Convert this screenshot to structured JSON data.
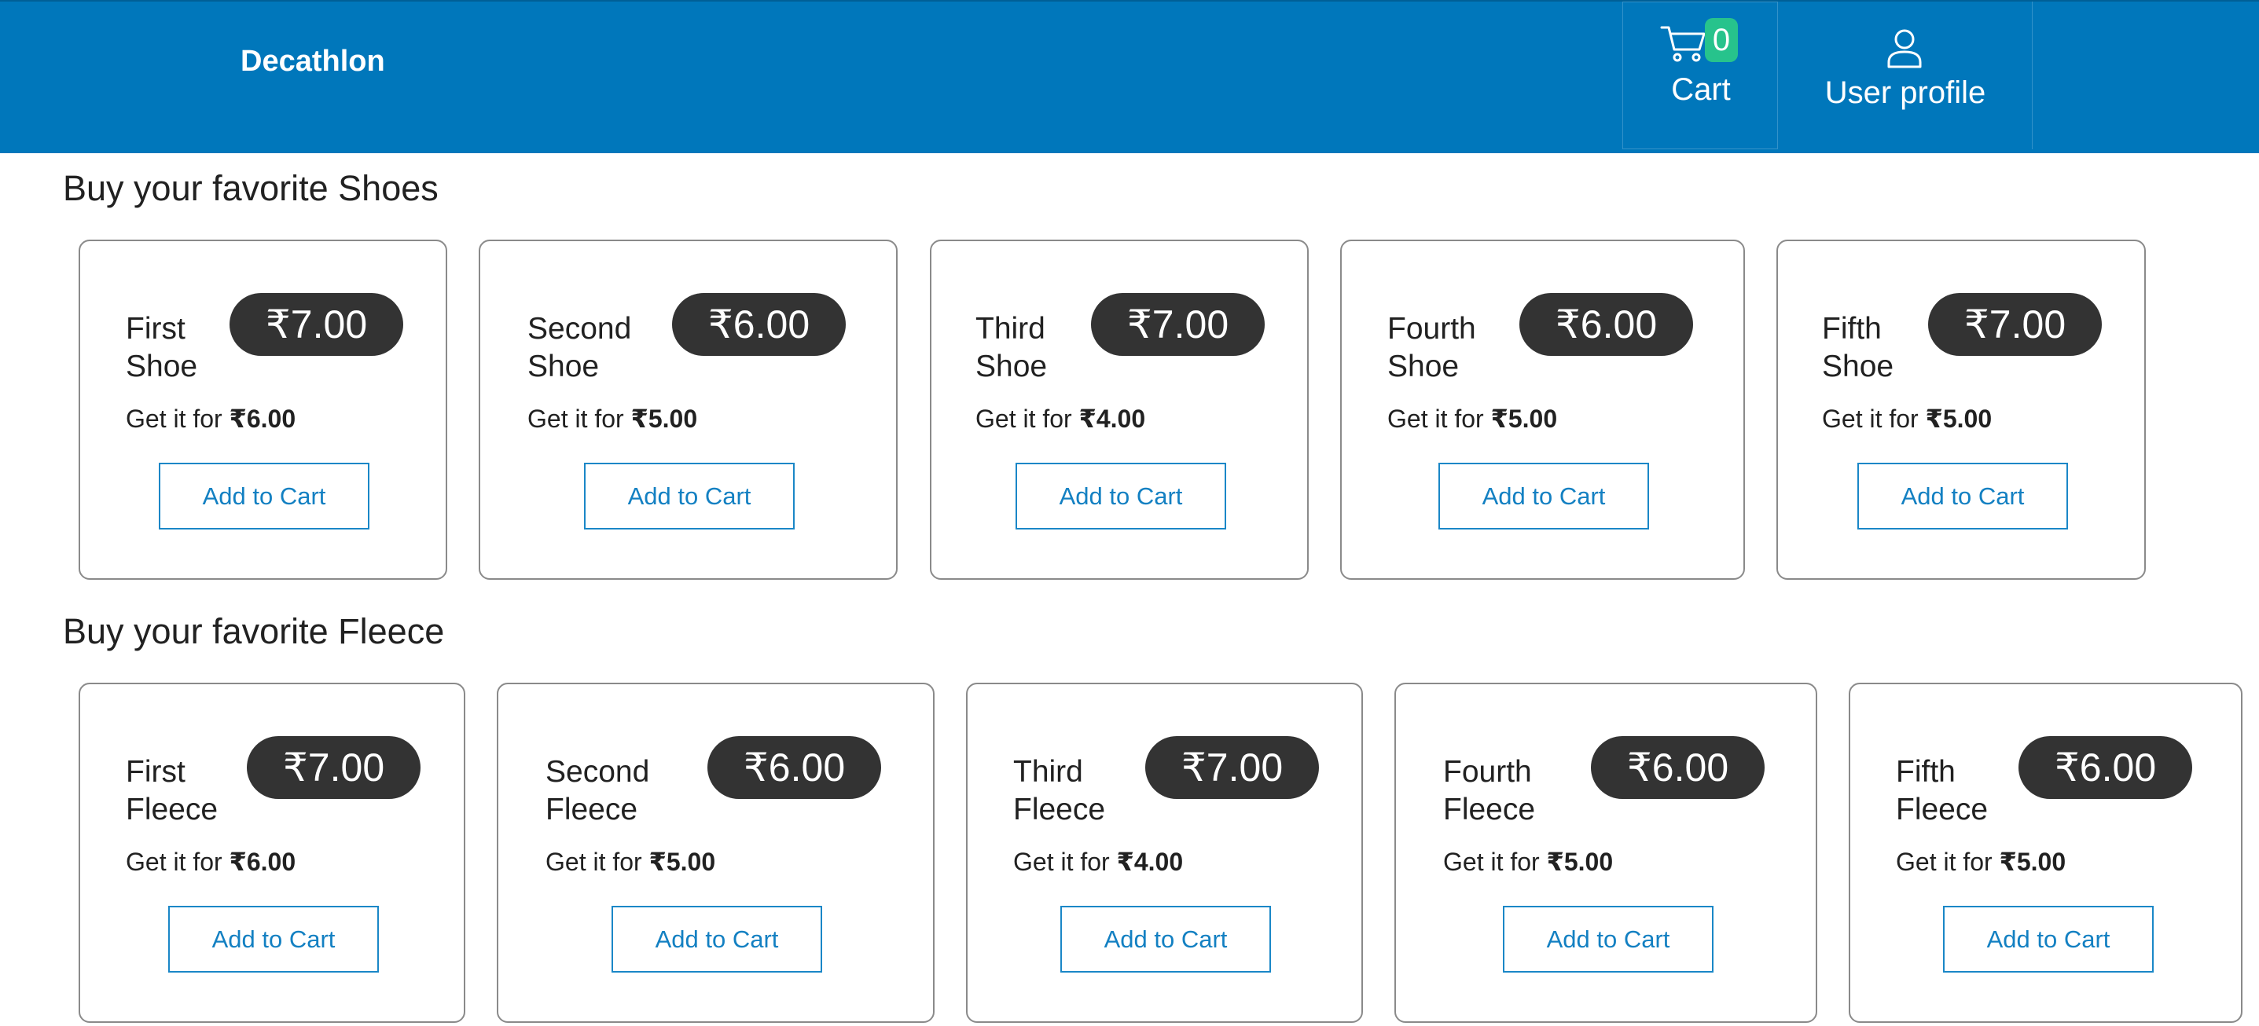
{
  "header": {
    "brand": "Decathlon",
    "cart": {
      "label": "Cart",
      "count": "0",
      "icon": "cart-icon"
    },
    "user": {
      "label": "User profile",
      "icon": "user-icon"
    },
    "bar_color": "#0077bb"
  },
  "shoes": {
    "title": "Buy your favorite Shoes",
    "items": [
      {
        "name_line1": "First",
        "name_line2": "Shoe",
        "price": "₹7.00",
        "offer_prefix": "Get it for ",
        "offer_price": "₹6.00",
        "button": "Add to Cart"
      },
      {
        "name_line1": "Second",
        "name_line2": "Shoe",
        "price": "₹6.00",
        "offer_prefix": "Get it for ",
        "offer_price": "₹5.00",
        "button": "Add to Cart"
      },
      {
        "name_line1": "Third",
        "name_line2": "Shoe",
        "price": "₹7.00",
        "offer_prefix": "Get it for ",
        "offer_price": "₹4.00",
        "button": "Add to Cart"
      },
      {
        "name_line1": "Fourth",
        "name_line2": "Shoe",
        "price": "₹6.00",
        "offer_prefix": "Get it for ",
        "offer_price": "₹5.00",
        "button": "Add to Cart"
      },
      {
        "name_line1": "Fifth",
        "name_line2": "Shoe",
        "price": "₹7.00",
        "offer_prefix": "Get it for ",
        "offer_price": "₹5.00",
        "button": "Add to Cart"
      }
    ]
  },
  "fleece": {
    "title": "Buy your favorite Fleece",
    "items": [
      {
        "name_line1": "First",
        "name_line2": "Fleece",
        "price": "₹7.00",
        "offer_prefix": "Get it for ",
        "offer_price": "₹6.00",
        "button": "Add to Cart"
      },
      {
        "name_line1": "Second",
        "name_line2": "Fleece",
        "price": "₹6.00",
        "offer_prefix": "Get it for ",
        "offer_price": "₹5.00",
        "button": "Add to Cart"
      },
      {
        "name_line1": "Third",
        "name_line2": "Fleece",
        "price": "₹7.00",
        "offer_prefix": "Get it for ",
        "offer_price": "₹4.00",
        "button": "Add to Cart"
      },
      {
        "name_line1": "Fourth",
        "name_line2": "Fleece",
        "price": "₹6.00",
        "offer_prefix": "Get it for ",
        "offer_price": "₹5.00",
        "button": "Add to Cart"
      },
      {
        "name_line1": "Fifth",
        "name_line2": "Fleece",
        "price": "₹6.00",
        "offer_prefix": "Get it for ",
        "offer_price": "₹5.00",
        "button": "Add to Cart"
      }
    ]
  }
}
